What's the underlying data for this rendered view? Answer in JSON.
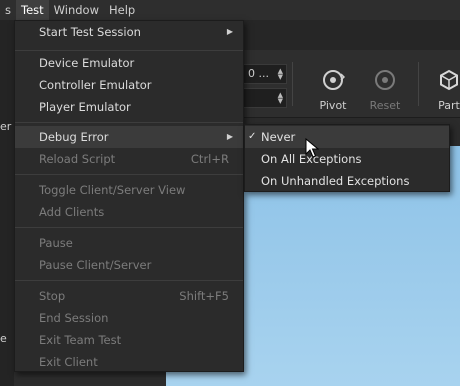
{
  "menubar": {
    "items": [
      {
        "label": "s"
      },
      {
        "label": "Test"
      },
      {
        "label": "Window"
      },
      {
        "label": "Help"
      }
    ]
  },
  "toolbar": {
    "field1_value": "0 ...",
    "field2_value": "",
    "pivot_label": "Pivot",
    "reset_label": "Reset",
    "part_label": "Part",
    "left_edge_text": "er",
    "left_edge_text2": "e"
  },
  "test_menu": {
    "items": [
      {
        "label": "Start Test Session",
        "submenu": true,
        "disabled": false
      },
      {
        "label": "Device Emulator",
        "disabled": false
      },
      {
        "label": "Controller Emulator",
        "disabled": false
      },
      {
        "label": "Player Emulator",
        "disabled": false
      },
      {
        "label": "Debug Error",
        "submenu": true,
        "disabled": false,
        "highlighted": true
      },
      {
        "label": "Reload Script",
        "shortcut": "Ctrl+R",
        "disabled": true
      },
      {
        "label": "Toggle Client/Server View",
        "disabled": true
      },
      {
        "label": "Add Clients",
        "disabled": true
      },
      {
        "label": "Pause",
        "disabled": true
      },
      {
        "label": "Pause Client/Server",
        "disabled": true
      },
      {
        "label": "Stop",
        "shortcut": "Shift+F5",
        "disabled": true
      },
      {
        "label": "End Session",
        "disabled": true
      },
      {
        "label": "Exit Team Test",
        "disabled": true
      },
      {
        "label": "Exit Client",
        "disabled": true
      }
    ]
  },
  "debug_error_submenu": {
    "items": [
      {
        "label": "Never",
        "checked": true,
        "highlighted": true
      },
      {
        "label": "On All Exceptions",
        "checked": false
      },
      {
        "label": "On Unhandled Exceptions",
        "checked": false
      }
    ]
  },
  "colors": {
    "menu_bg": "#2b2b2b",
    "highlight": "#3b3b3b",
    "disabled_text": "#7c7c7c",
    "viewport_sky": "#9ccbeb"
  }
}
